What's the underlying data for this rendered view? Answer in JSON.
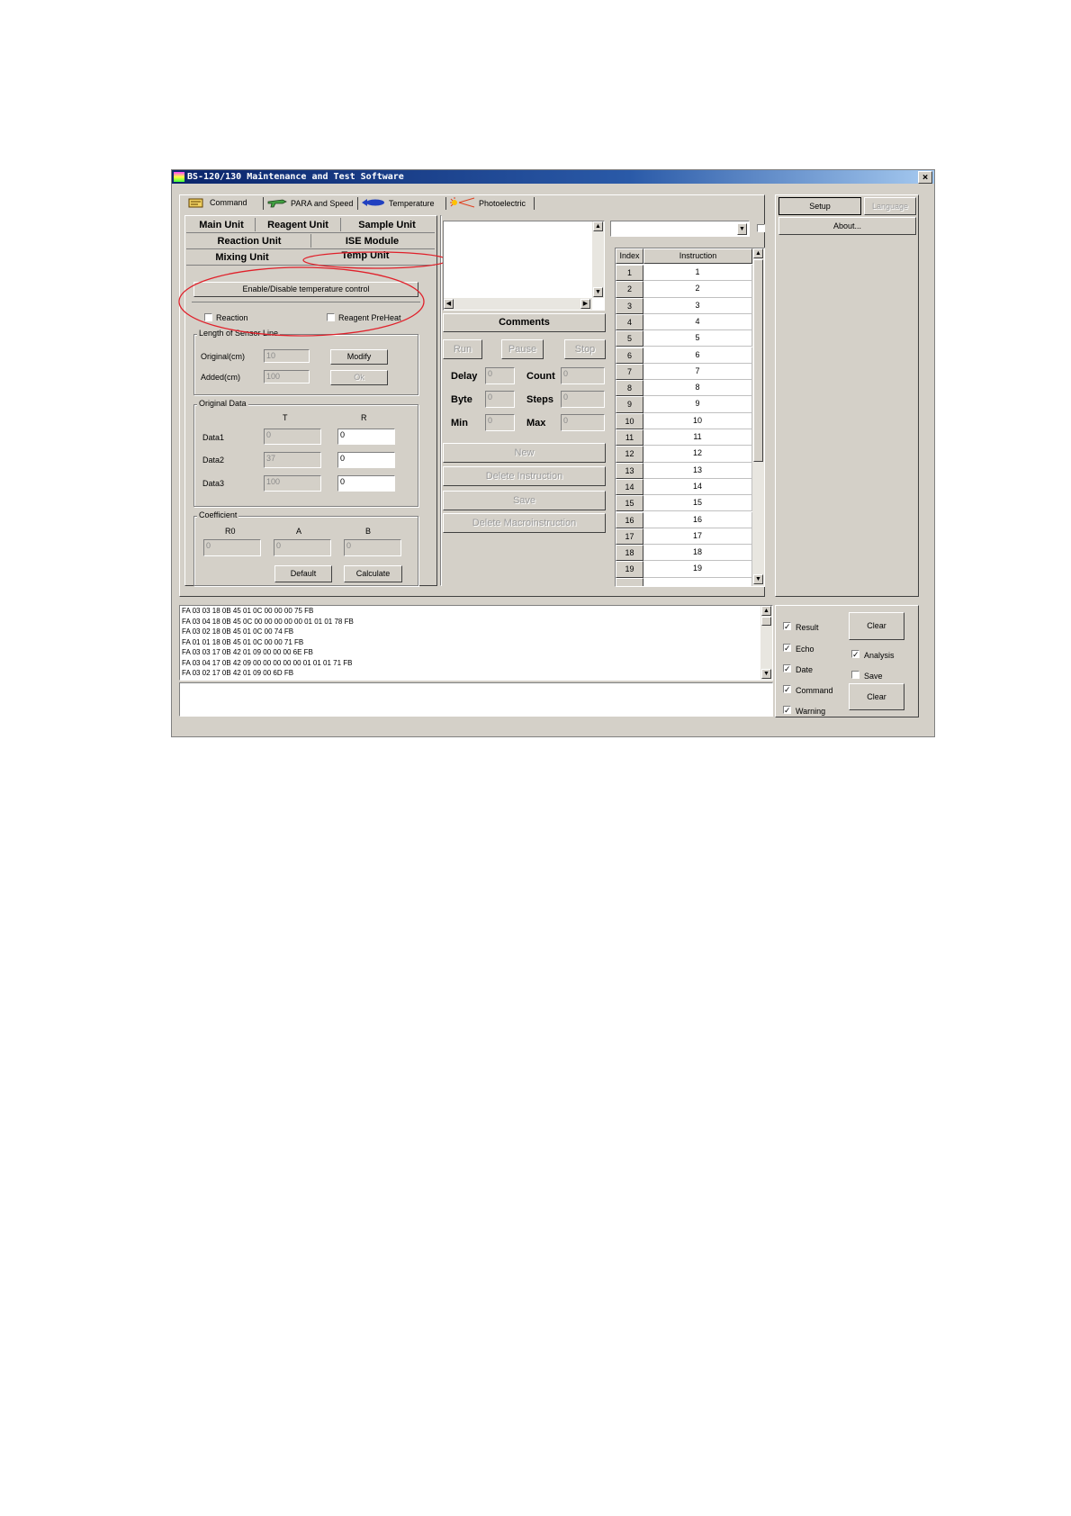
{
  "window": {
    "title": "BS-120/130 Maintenance and Test Software",
    "close": "×"
  },
  "tabs": [
    {
      "label": "Command",
      "icon": "command-icon"
    },
    {
      "label": "PARA and Speed",
      "icon": "gun-icon"
    },
    {
      "label": "Temperature",
      "icon": "fish-icon"
    },
    {
      "label": "Photoelectric",
      "icon": "light-icon"
    }
  ],
  "units": {
    "main": "Main Unit",
    "reagent": "Reagent Unit",
    "sample": "Sample Unit",
    "reaction": "Reaction Unit",
    "ise": "ISE Module",
    "mixing": "Mixing Unit",
    "temp": "Temp Unit"
  },
  "temp_panel": {
    "enable_button": "Enable/Disable temperature control",
    "reaction_checkbox": "Reaction",
    "preheat_checkbox": "Reagent PreHeat",
    "sensor_group": "Length of Sensor Line",
    "original_label": "Original(cm)",
    "original_value": "10",
    "added_label": "Added(cm)",
    "added_value": "100",
    "modify_button": "Modify",
    "ok_button": "Ok",
    "data_group": "Original Data",
    "col_t": "T",
    "col_r": "R",
    "rows": [
      {
        "label": "Data1",
        "t": "0",
        "r": "0"
      },
      {
        "label": "Data2",
        "t": "37",
        "r": "0"
      },
      {
        "label": "Data3",
        "t": "100",
        "r": "0"
      }
    ],
    "coef_group": "Coefficient",
    "coef_labels": [
      "R0",
      "A",
      "B"
    ],
    "coef_values": [
      "0",
      "0",
      "0"
    ],
    "default_button": "Default",
    "calculate_button": "Calculate"
  },
  "macro_panel": {
    "comments_button": "Comments",
    "run": "Run",
    "pause": "Pause",
    "stop": "Stop",
    "delay_label": "Delay",
    "delay_value": "0",
    "count_label": "Count",
    "count_value": "0",
    "byte_label": "Byte",
    "byte_value": "0",
    "steps_label": "Steps",
    "steps_value": "0",
    "min_label": "Min",
    "min_value": "0",
    "max_label": "Max",
    "max_value": "0",
    "new": "New",
    "delete_instruction": "Delete Instruction",
    "save": "Save",
    "delete_macro": "Delete Macroinstruction"
  },
  "instruction_table": {
    "headers": [
      "Index",
      "Instruction"
    ],
    "rows": [
      [
        "1",
        "1"
      ],
      [
        "2",
        "2"
      ],
      [
        "3",
        "3"
      ],
      [
        "4",
        "4"
      ],
      [
        "5",
        "5"
      ],
      [
        "6",
        "6"
      ],
      [
        "7",
        "7"
      ],
      [
        "8",
        "8"
      ],
      [
        "9",
        "9"
      ],
      [
        "10",
        "10"
      ],
      [
        "11",
        "11"
      ],
      [
        "12",
        "12"
      ],
      [
        "13",
        "13"
      ],
      [
        "14",
        "14"
      ],
      [
        "15",
        "15"
      ],
      [
        "16",
        "16"
      ],
      [
        "17",
        "17"
      ],
      [
        "18",
        "18"
      ],
      [
        "19",
        "19"
      ]
    ]
  },
  "right_panel": {
    "setup": "Setup",
    "language": "Language",
    "about": "About..."
  },
  "log_lines": [
    "FA 03 03 18 0B 45 01 0C 00 00 00 75 FB",
    "FA 03 04 18 0B 45 0C 00 00 00 00 00 01 01 01 78 FB",
    "FA 03 02 18 0B 45 01 0C 00 74 FB",
    "FA 01 01 18 0B 45 01 0C 00 00 71 FB",
    "FA 03 03 17 0B 42 01 09 00 00 00 6E FB",
    "FA 03 04 17 0B 42 09 00 00 00 00 00 01 01 01 71 FB",
    "FA 03 02 17 0B 42 01 09 00 6D FB"
  ],
  "log_options": {
    "result": "Result",
    "echo": "Echo",
    "date": "Date",
    "command": "Command",
    "warning": "Warning",
    "analysis": "Analysis",
    "save": "Save",
    "clear1": "Clear",
    "clear2": "Clear",
    "check": "✓"
  },
  "colors": {
    "face": "#d4d0c8",
    "title_start": "#0a246a",
    "highlight_red": "#e0202a"
  }
}
